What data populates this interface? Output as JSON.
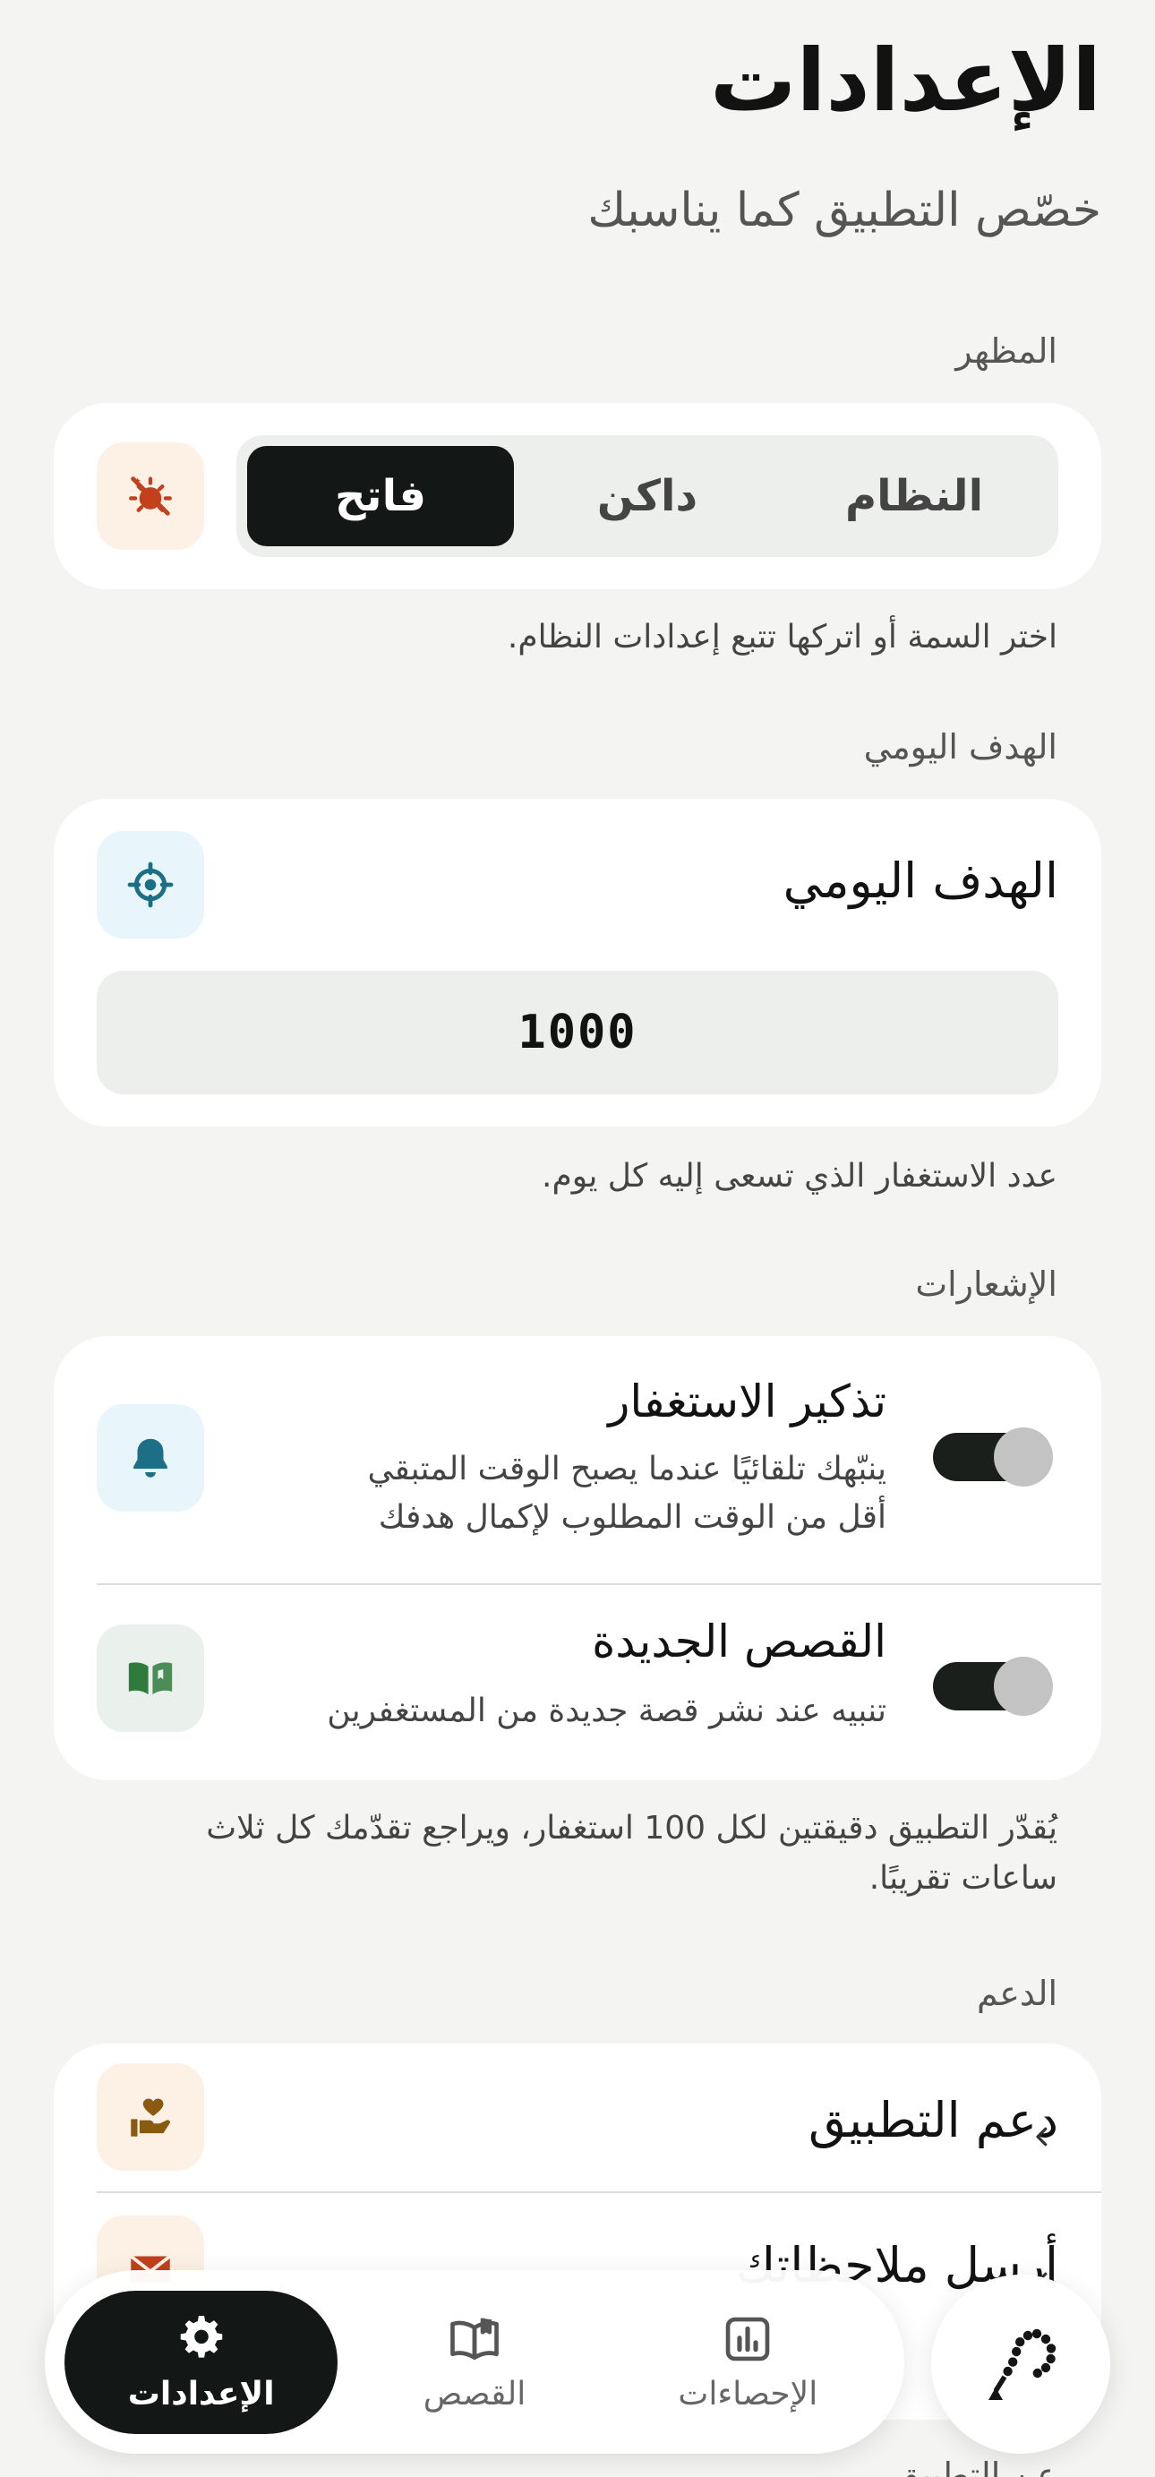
{
  "header": {
    "title": "الإعدادات",
    "subtitle": "خصّص التطبيق كما يناسبك"
  },
  "appearance": {
    "section_label": "المظهر",
    "options": [
      "النظام",
      "داكن",
      "فاتح"
    ],
    "selected": "فاتح",
    "icon": "theme-sun-moon-icon",
    "note": "اختر السمة أو اتركها تتبع إعدادات النظام."
  },
  "daily_goal": {
    "section_label": "الهدف اليومي",
    "title": "الهدف اليومي",
    "value": "1000",
    "icon": "target-icon",
    "note": "عدد الاستغفار الذي تسعى إليه كل يوم."
  },
  "notifications": {
    "section_label": "الإشعارات",
    "items": [
      {
        "title": "تذكير الاستغفار",
        "desc_line1": "ينبّهك تلقائيًا عندما يصبح الوقت المتبقي",
        "desc_line2": "أقل من الوقت المطلوب لإكمال هدفك",
        "enabled": true,
        "icon": "bell-icon"
      },
      {
        "title": "القصص الجديدة",
        "desc_line1": "تنبيه عند نشر قصة جديدة من المستغفرين",
        "enabled": true,
        "icon": "open-book-icon"
      }
    ],
    "note_line1": "يُقدّر التطبيق دقيقتين لكل 100 استغفار، ويراجع تقدّمك كل ثلاث",
    "note_line2": "ساعات تقريبًا."
  },
  "support": {
    "section_label": "الدعم",
    "items": [
      {
        "title": "دعم التطبيق",
        "icon": "heart-hand-icon"
      },
      {
        "title": "أرسل ملاحظاتك",
        "icon": "envelope-icon"
      }
    ],
    "partial_label": "عن التطبيق"
  },
  "tabbar": {
    "tabs": [
      {
        "label": "الإعدادات",
        "icon": "gear-icon",
        "active": true
      },
      {
        "label": "القصص",
        "icon": "book-icon",
        "active": false
      },
      {
        "label": "الإحصاءات",
        "icon": "chart-icon",
        "active": false
      }
    ],
    "fab_icon": "prayer-beads-icon"
  },
  "colors": {
    "background": "#f4f4f2",
    "dark": "#131816",
    "appearance_icon_bg": "#fdf1e5",
    "appearance_icon": "#c2401c",
    "goal_icon_bg": "#e8f6fb",
    "goal_icon": "#1d6f86",
    "bell_icon_bg": "#e8f6fb",
    "bell_icon": "#1d6f86",
    "book_icon_bg": "#eaf1ec",
    "book_icon": "#2f7a3d",
    "support_icon_bg": "#fdf1e5",
    "support_icon": "#8a5a10",
    "mail_icon": "#c2401c"
  }
}
